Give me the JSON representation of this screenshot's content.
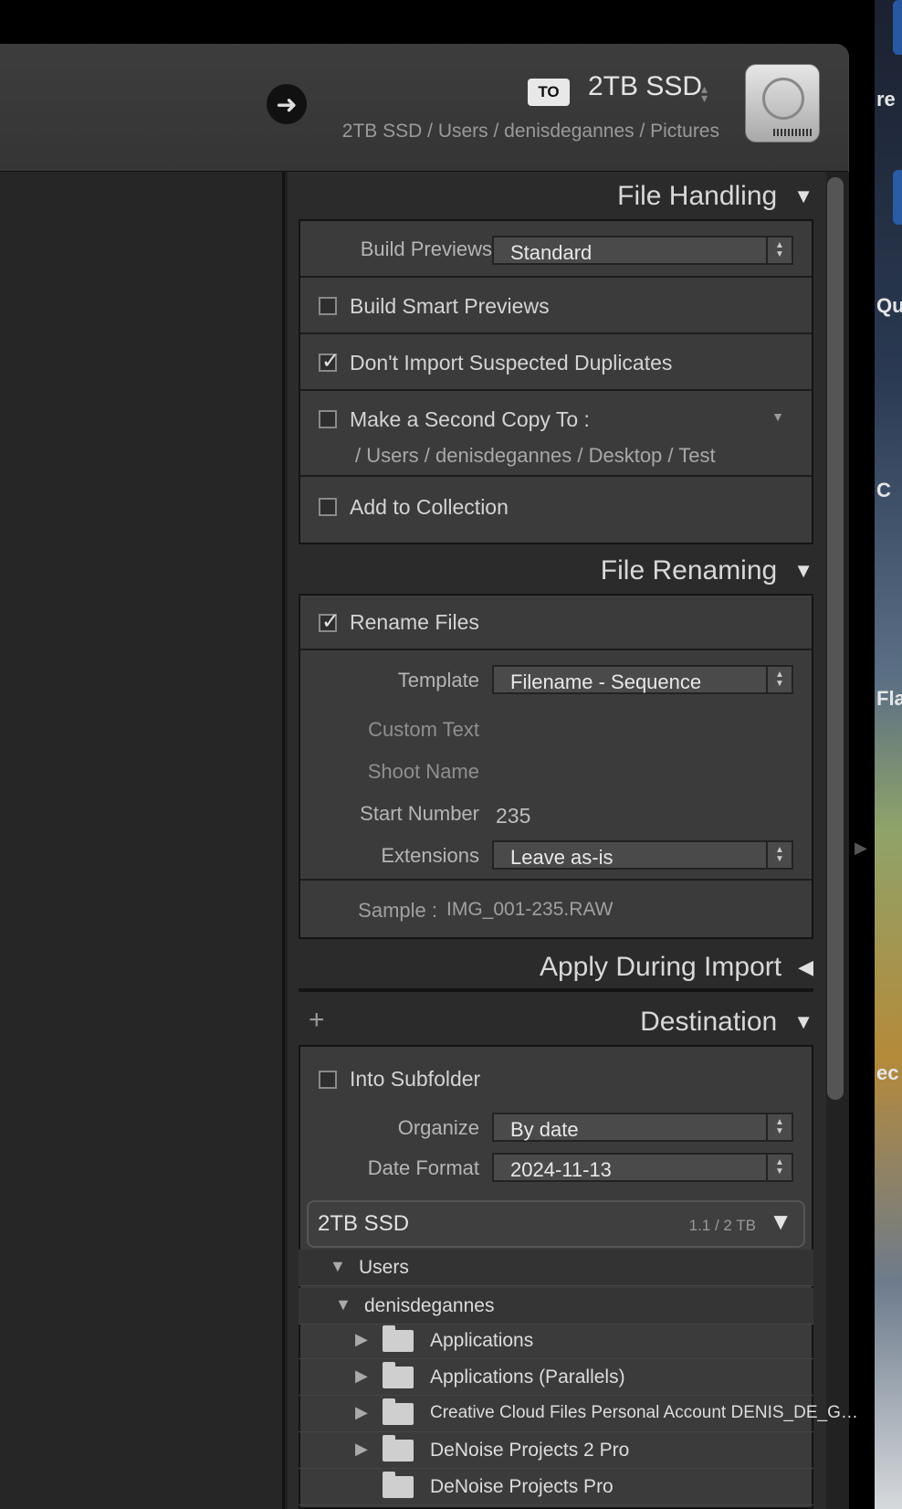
{
  "header": {
    "to_badge": "TO",
    "destination_name": "2TB SSD",
    "destination_path": "2TB SSD / Users / denisdegannes / Pictures"
  },
  "file_handling": {
    "title": "File Handling",
    "build_previews_label": "Build Previews",
    "build_previews_value": "Standard",
    "build_smart_previews": {
      "label": "Build Smart Previews",
      "checked": false
    },
    "dont_import_duplicates": {
      "label": "Don't Import Suspected Duplicates",
      "checked": true
    },
    "second_copy": {
      "label": "Make a Second Copy To :",
      "path": "/ Users / denisdegannes / Desktop / Test",
      "checked": false
    },
    "add_to_collection": {
      "label": "Add to Collection",
      "checked": false
    }
  },
  "file_renaming": {
    "title": "File Renaming",
    "rename_files": {
      "label": "Rename Files",
      "checked": true
    },
    "template_label": "Template",
    "template_value": "Filename - Sequence",
    "custom_text_label": "Custom Text",
    "shoot_name_label": "Shoot Name",
    "start_number_label": "Start Number",
    "start_number_value": "235",
    "extensions_label": "Extensions",
    "extensions_value": "Leave as-is",
    "sample_label": "Sample :",
    "sample_value": "IMG_001-235.RAW"
  },
  "apply_during_import": {
    "title": "Apply During Import"
  },
  "destination": {
    "title": "Destination",
    "into_subfolder": {
      "label": "Into Subfolder",
      "checked": false
    },
    "organize_label": "Organize",
    "organize_value": "By date",
    "date_format_label": "Date Format",
    "date_format_value": "2024-11-13",
    "volume": {
      "name": "2TB SSD",
      "capacity": "1.1 / 2 TB"
    },
    "tree": {
      "users": "Users",
      "user": "denisdegannes",
      "folders": [
        "Applications",
        "Applications (Parallels)",
        "Creative Cloud Files Personal Account DENIS_DE_G…",
        "DeNoise Projects 2 Pro",
        "DeNoise Projects Pro"
      ]
    }
  },
  "background_fragments": [
    "re",
    "Que",
    "C",
    "Fla",
    "ec"
  ]
}
